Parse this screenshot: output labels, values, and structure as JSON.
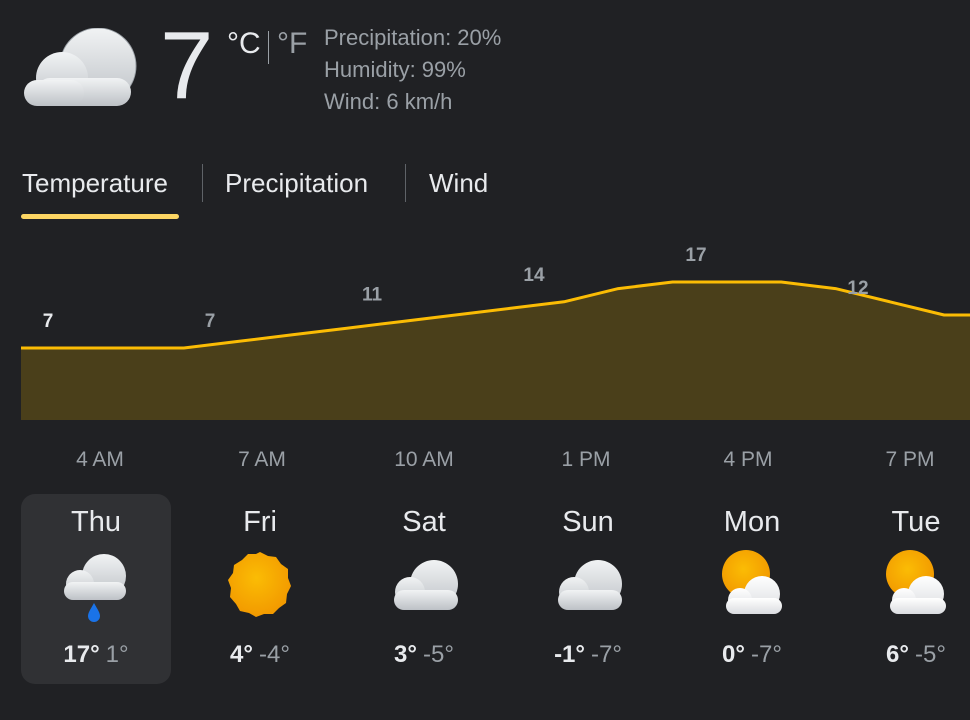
{
  "current": {
    "icon": "cloudy-icon",
    "temperature": "7",
    "unit_celsius": "°C",
    "unit_fahrenheit": "°F",
    "precipitation": "Precipitation: 20%",
    "humidity": "Humidity: 99%",
    "wind": "Wind: 6 km/h"
  },
  "tabs": [
    {
      "label": "Temperature",
      "selected": true
    },
    {
      "label": "Precipitation",
      "selected": false
    },
    {
      "label": "Wind",
      "selected": false
    }
  ],
  "colors": {
    "background": "#202124",
    "accent_line": "#fbbc04",
    "area_fill": "#4a3f1a",
    "selected_day_bg": "#303134",
    "muted_text": "#9aa0a6"
  },
  "chart_data": {
    "type": "area",
    "labeled_points": [
      {
        "time": "4 AM",
        "value": 7
      },
      {
        "time": "7 AM",
        "value": 7
      },
      {
        "time": "10 AM",
        "value": 11
      },
      {
        "time": "1 PM",
        "value": 14
      },
      {
        "time": "4 PM",
        "value": 17
      },
      {
        "time": "7 PM",
        "value": 12
      }
    ],
    "x_labels": [
      "4 AM",
      "7 AM",
      "10 AM",
      "1 PM",
      "4 PM",
      "7 PM"
    ],
    "hourly_values": [
      7,
      7,
      7,
      7,
      8,
      9,
      10,
      11,
      12,
      13,
      14,
      16,
      17,
      17,
      17,
      16,
      14,
      12,
      12,
      13
    ],
    "ylim": [
      0,
      17
    ]
  },
  "forecast": [
    {
      "day": "Thu",
      "icon": "cloud-rain-icon",
      "high": "17°",
      "low": "1°",
      "selected": true
    },
    {
      "day": "Fri",
      "icon": "sun-icon",
      "high": "4°",
      "low": "-4°",
      "selected": false
    },
    {
      "day": "Sat",
      "icon": "cloudy-icon",
      "high": "3°",
      "low": "-5°",
      "selected": false
    },
    {
      "day": "Sun",
      "icon": "cloudy-icon",
      "high": "-1°",
      "low": "-7°",
      "selected": false
    },
    {
      "day": "Mon",
      "icon": "partly-cloudy-icon",
      "high": "0°",
      "low": "-7°",
      "selected": false
    },
    {
      "day": "Tue",
      "icon": "partly-cloudy-icon",
      "high": "6°",
      "low": "-5°",
      "selected": false
    }
  ]
}
